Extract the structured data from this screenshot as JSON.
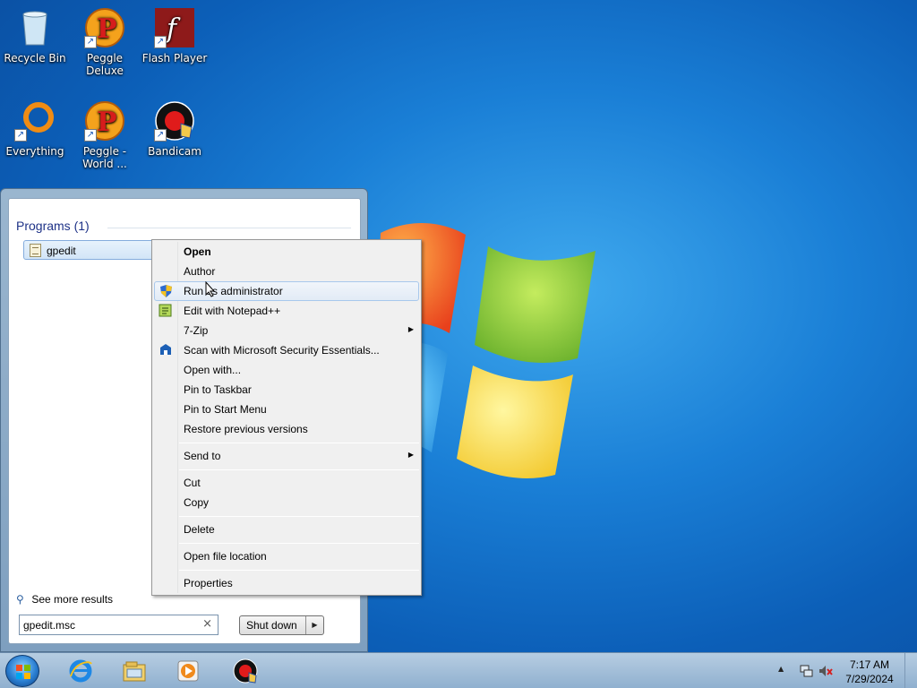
{
  "desktop": {
    "icons": [
      {
        "label": "Recycle Bin",
        "icon": "recycle-bin-icon"
      },
      {
        "label": "Peggle Deluxe",
        "icon": "peggle-icon"
      },
      {
        "label": "Flash Player",
        "icon": "flash-icon"
      },
      {
        "label": "Everything",
        "icon": "everything-icon"
      },
      {
        "label": "Peggle - World ...",
        "icon": "peggle-icon"
      },
      {
        "label": "Bandicam",
        "icon": "bandicam-icon"
      }
    ]
  },
  "start_menu": {
    "heading": "Programs (1)",
    "result": "gpedit",
    "see_more": "See more results",
    "search_value": "gpedit.msc",
    "clear_glyph": "×",
    "shutdown_label": "Shut down",
    "shutdown_arrow": "▶"
  },
  "context_menu": {
    "items": [
      {
        "label": "Open",
        "bold": true
      },
      {
        "label": "Author"
      },
      {
        "label": "Run as administrator",
        "icon": "uac-shield-icon",
        "hover": true
      },
      {
        "label": "Edit with Notepad++",
        "icon": "notepadpp-icon"
      },
      {
        "label": "7-Zip",
        "submenu": true
      },
      {
        "label": "Scan with Microsoft Security Essentials...",
        "icon": "mse-icon"
      },
      {
        "label": "Open with..."
      },
      {
        "label": "Pin to Taskbar"
      },
      {
        "label": "Pin to Start Menu"
      },
      {
        "label": "Restore previous versions"
      },
      {
        "label": "Send to",
        "submenu": true
      },
      {
        "label": "Cut"
      },
      {
        "label": "Copy"
      },
      {
        "label": "Delete"
      },
      {
        "label": "Open file location"
      },
      {
        "label": "Properties"
      }
    ],
    "submenu_glyph": "▶"
  },
  "taskbar": {
    "pinned": [
      "internet-explorer-icon",
      "windows-explorer-icon",
      "media-player-icon",
      "bandicam-icon"
    ],
    "tray_arrow": "▲",
    "time": "7:17 AM",
    "date": "7/29/2024"
  }
}
